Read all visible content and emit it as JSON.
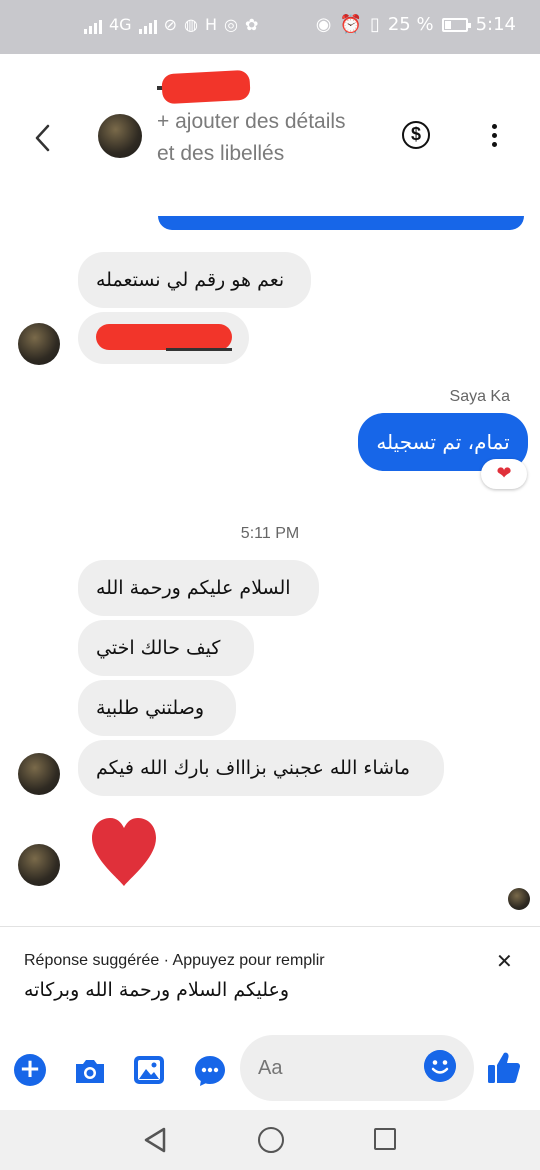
{
  "status_bar": {
    "network": "4G",
    "carrier_letter": "H",
    "battery_percent": "25 %",
    "time": "5:14"
  },
  "header": {
    "subtitle": "+ ajouter des détails et des libellés"
  },
  "messages": [
    {
      "side": "in",
      "text": "نعم هو رقم لي نستعمله"
    },
    {
      "side": "in",
      "text": ""
    },
    {
      "side": "out",
      "sender": "Saya Ka",
      "text": "تمام، تم تسجيله",
      "reaction": "heart"
    },
    {
      "side": "in",
      "text": "السلام عليكم ورحمة الله"
    },
    {
      "side": "in",
      "text": "كيف حالك اختي"
    },
    {
      "side": "in",
      "text": "وصلتني طلبية"
    },
    {
      "side": "in",
      "text": "ماشاء الله عجبني بزاااف بارك الله فيكم"
    },
    {
      "side": "in",
      "text": "heart-sticker"
    }
  ],
  "timestamp": "5:11 PM",
  "suggestion": {
    "label": "Réponse suggérée · Appuyez pour remplir",
    "text": "وعليكم السلام ورحمة الله وبركاته"
  },
  "composer": {
    "placeholder": "Aa"
  },
  "colors": {
    "accent": "#1766e8",
    "incoming_bubble": "#eeeeee",
    "heart": "#e0303a"
  }
}
